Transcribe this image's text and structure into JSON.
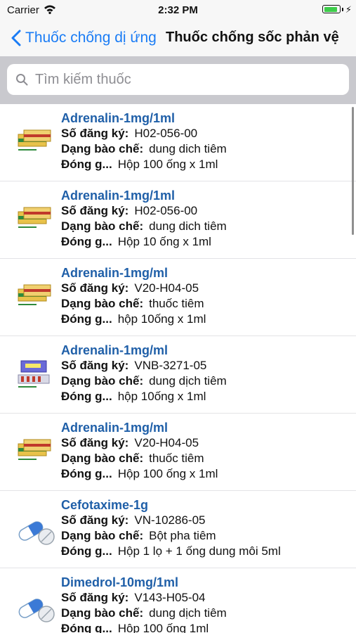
{
  "status_bar": {
    "carrier": "Carrier",
    "time": "2:32 PM",
    "battery_level": 0.9
  },
  "nav": {
    "back_label": "Thuốc chống dị ứng",
    "title": "Thuốc chống sốc phản vệ"
  },
  "search": {
    "placeholder": "Tìm kiếm thuốc",
    "value": ""
  },
  "labels": {
    "reg": "Số đăng ký:",
    "form": "Dạng bào chế:",
    "pack": "Đóng g..."
  },
  "colors": {
    "accent": "#1a7cf5",
    "drug_name": "#1f5fa8",
    "search_bg": "#c9c9ce"
  },
  "drugs": [
    {
      "name": "Adrenalin-1mg/1ml",
      "reg": "H02-056-00",
      "form": "dung dich tiêm",
      "pack": "Hộp 100 ống x 1ml",
      "icon": "ampoule-box-icon"
    },
    {
      "name": "Adrenalin-1mg/1ml",
      "reg": "H02-056-00",
      "form": "dung dich tiêm",
      "pack": "Hộp 10 ống x 1ml",
      "icon": "ampoule-box-icon"
    },
    {
      "name": "Adrenalin-1mg/ml",
      "reg": "V20-H04-05",
      "form": "thuốc tiêm",
      "pack": "hộp 10ống x 1ml",
      "icon": "ampoule-box-icon"
    },
    {
      "name": "Adrenalin-1mg/ml",
      "reg": "VNB-3271-05",
      "form": "dung dịch tiêm",
      "pack": "hộp 10ống x 1ml",
      "icon": "ampoule-package-icon"
    },
    {
      "name": "Adrenalin-1mg/ml",
      "reg": "V20-H04-05",
      "form": "thuốc tiêm",
      "pack": "Hộp 100 ống x 1ml",
      "icon": "ampoule-box-icon"
    },
    {
      "name": "Cefotaxime-1g",
      "reg": "VN-10286-05",
      "form": "Bột pha tiêm",
      "pack": "Hộp 1 lọ + 1 ống dung môi 5ml",
      "icon": "capsule-pill-icon"
    },
    {
      "name": "Dimedrol-10mg/1ml",
      "reg": "V143-H05-04",
      "form": "dung dịch tiêm",
      "pack": "Hộp 100 ống 1ml",
      "icon": "capsule-pill-icon"
    }
  ]
}
